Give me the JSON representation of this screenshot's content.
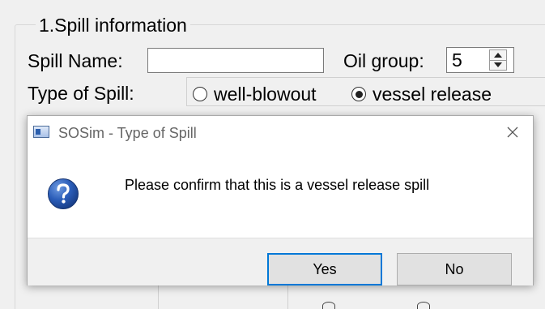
{
  "background": {
    "group_title": "1.Spill information",
    "spill_name_label": "Spill Name:",
    "spill_name_value": "",
    "oil_group_label": "Oil group:",
    "oil_group_value": "5",
    "type_of_spill_label": "Type of Spill:",
    "radio_options": [
      {
        "label": "well-blowout",
        "selected": false
      },
      {
        "label": "vessel release",
        "selected": true
      }
    ]
  },
  "dialog": {
    "title": "SOSim - Type of Spill",
    "message": "Please confirm that this is a vessel release spill",
    "icon": "question-icon",
    "buttons": {
      "yes_label": "Yes",
      "no_label": "No"
    },
    "default_button": "Yes"
  },
  "colors": {
    "focus_border": "#0078d7",
    "question_icon_blue": "#1f4fa8",
    "window_bg": "#f0f0f0"
  }
}
